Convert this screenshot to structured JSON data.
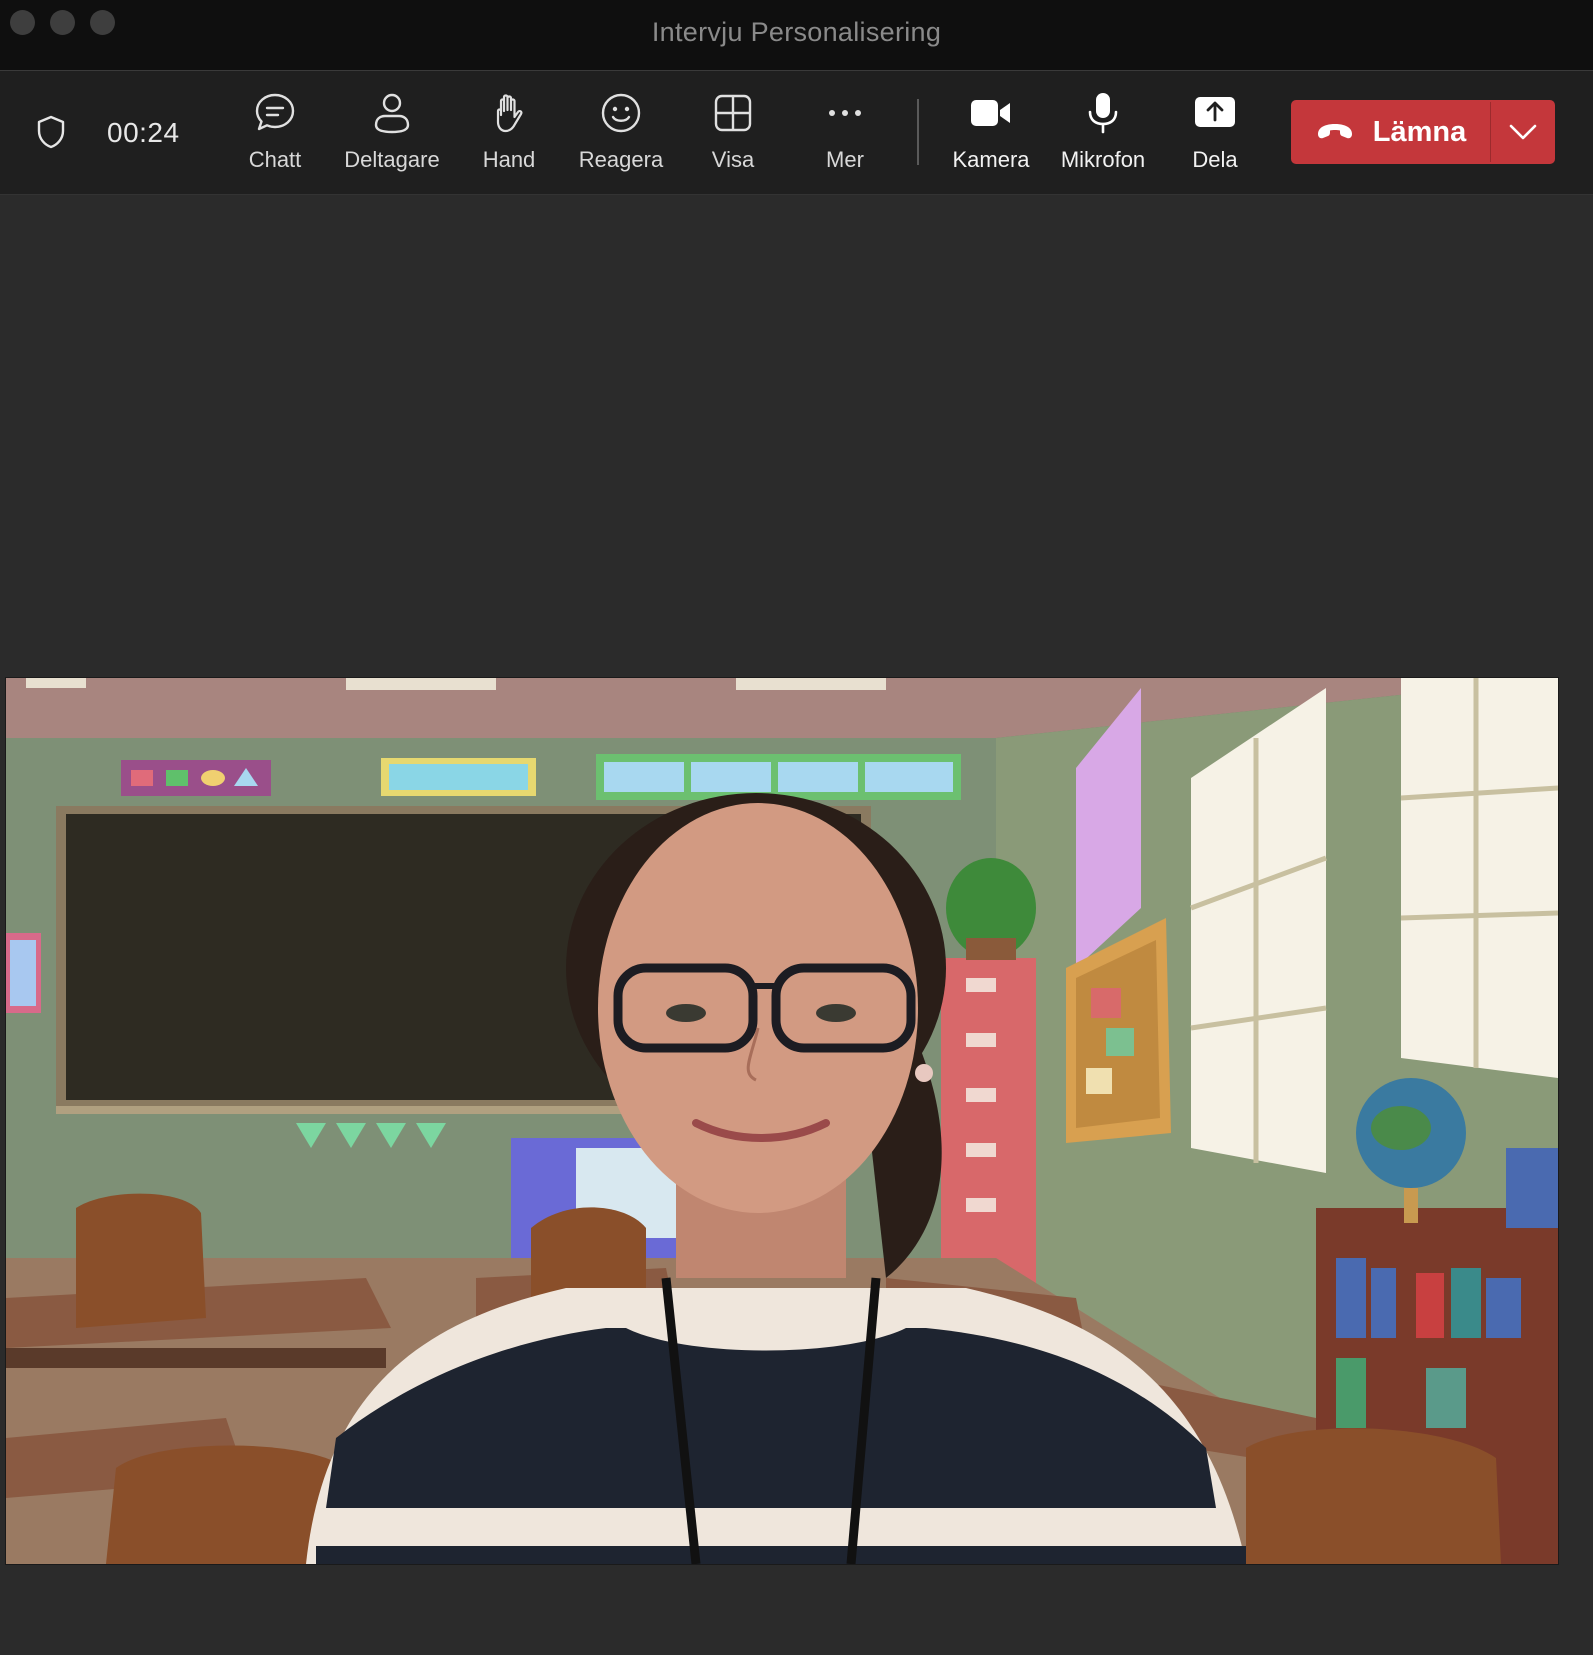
{
  "window": {
    "title": "Intervju Personalisering"
  },
  "toolbar": {
    "timer": "00:24",
    "buttons": {
      "chat": "Chatt",
      "participants": "Deltagare",
      "hand": "Hand",
      "react": "Reagera",
      "view": "Visa",
      "more": "Mer",
      "camera": "Kamera",
      "microphone": "Mikrofon",
      "share": "Dela"
    },
    "leave_label": "Lämna"
  },
  "icons": {
    "security": "shield-icon",
    "chat": "chat-bubble-icon",
    "participants": "person-icon",
    "hand": "raise-hand-icon",
    "react": "smiley-icon",
    "view": "grid-icon",
    "more": "ellipsis-icon",
    "camera": "video-camera-icon",
    "microphone": "microphone-icon",
    "share": "share-screen-icon",
    "leave": "phone-hangup-icon",
    "leave_options": "chevron-down-icon"
  },
  "colors": {
    "titlebar": "#0f0f0f",
    "toolbar": "#1f1f1f",
    "stage": "#2b2b2b",
    "leave_button": "#c4373b"
  }
}
